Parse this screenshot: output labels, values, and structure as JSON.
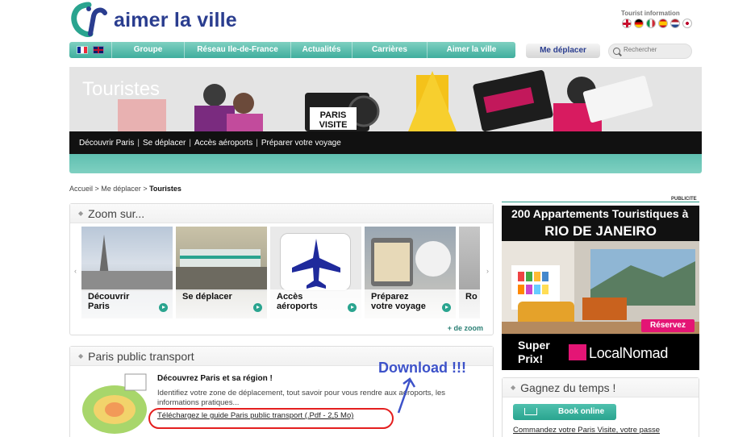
{
  "header": {
    "logo_text": "aimer la ville",
    "tourist_info": "Tourist information",
    "languages": [
      "english-flag",
      "german-flag",
      "italian-flag",
      "spanish-flag",
      "dutch-flag",
      "japanese-flag"
    ]
  },
  "nav": {
    "items": [
      "Groupe",
      "Réseau Ile-de-France",
      "Actualités",
      "Carrières",
      "Aimer la ville"
    ],
    "me_deplacer": "Me déplacer",
    "search_placeholder": "Rechercher"
  },
  "banner": {
    "title": "Touristes",
    "submenu": [
      "Découvrir Paris",
      "Se déplacer",
      "Accès aéroports",
      "Préparer votre voyage"
    ]
  },
  "breadcrumb": {
    "items": [
      "Accueil",
      "Me déplacer"
    ],
    "current": "Touristes"
  },
  "zoom": {
    "title": "Zoom sur...",
    "tiles": [
      {
        "line1": "Découvrir",
        "line2": "Paris"
      },
      {
        "line1": "Se déplacer",
        "line2": ""
      },
      {
        "line1": "Accès",
        "line2": "aéroports"
      },
      {
        "line1": "Préparez",
        "line2": "votre voyage"
      },
      {
        "line1": "Ro",
        "line2": ""
      }
    ],
    "more": "+ de zoom"
  },
  "transport": {
    "title": "Paris public transport",
    "heading": "Découvrez Paris et sa région !",
    "text": "Identifiez votre zone de déplacement, tout savoir pour vous rendre aux aéroports, les informations pratiques...",
    "link": "Téléchargez le guide Paris public transport (.Pdf - 2,5 Mo)",
    "annotation": "Download !!!"
  },
  "ad": {
    "label": "PUBLICITE",
    "line1": "200 Appartements Touristiques à",
    "line2": "RIO DE JANEIRO",
    "cta": "Réservez",
    "super": "Super",
    "prix": "Prix!",
    "brand": "LocalNomad"
  },
  "gagnez": {
    "title": "Gagnez du temps !",
    "button": "Book online",
    "text": "Commandez votre Paris Visite, votre passe"
  },
  "colors": {
    "teal": "#3fae9d",
    "navy": "#2a3d8f",
    "red_annotation": "#e41f1f",
    "blue_annotation": "#3d52c9"
  }
}
